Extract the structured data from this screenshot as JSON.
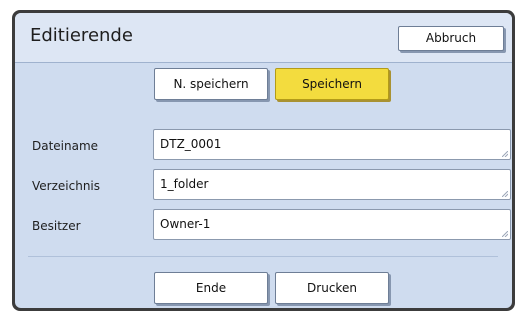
{
  "dialog": {
    "title": "Editierende",
    "cancel_label": "Abbruch"
  },
  "save_row": {
    "save_as_label": "N. speichern",
    "save_label": "Speichern",
    "save_color": "#f3dc3e"
  },
  "fields": {
    "filename": {
      "label": "Dateiname",
      "value": "DTZ_0001"
    },
    "directory": {
      "label": "Verzeichnis",
      "value": "1_folder"
    },
    "owner": {
      "label": "Besitzer",
      "value": "Owner-1"
    }
  },
  "footer": {
    "end_label": "Ende",
    "print_label": "Drucken"
  },
  "icons": {
    "resize_grip": "resize-grip-icon"
  }
}
